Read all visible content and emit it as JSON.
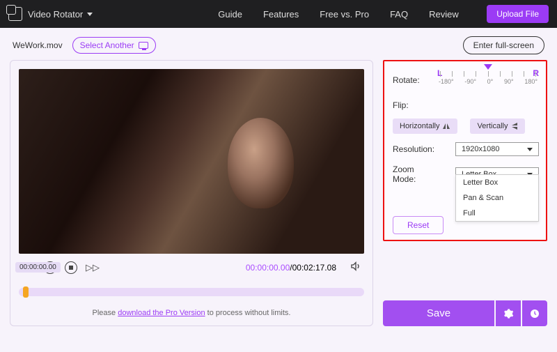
{
  "header": {
    "title": "Video Rotator",
    "nav": [
      "Guide",
      "Features",
      "Free vs. Pro",
      "FAQ",
      "Review"
    ],
    "upload": "Upload File"
  },
  "file": {
    "name": "WeWork.mov",
    "select_another": "Select Another",
    "fullscreen": "Enter full-screen"
  },
  "player": {
    "current": "00:00:00.00",
    "duration": "00:02:17.08",
    "tooltip": "00:00:00.00",
    "footer_prefix": "Please ",
    "footer_link": "download the Pro Version",
    "footer_suffix": " to process without limits."
  },
  "settings": {
    "rotate_label": "Rotate:",
    "rotate_L": "L",
    "rotate_R": "R",
    "tick_labels": [
      "-180°",
      "-90°",
      "0°",
      "90°",
      "180°"
    ],
    "flip_label": "Flip:",
    "flip_h": "Horizontally",
    "flip_v": "Vertically",
    "resolution_label": "Resolution:",
    "resolution_value": "1920x1080",
    "zoom_label": "Zoom Mode:",
    "zoom_value": "Letter Box",
    "zoom_options": [
      "Letter Box",
      "Pan & Scan",
      "Full"
    ],
    "reset": "Reset"
  },
  "actions": {
    "save": "Save"
  }
}
